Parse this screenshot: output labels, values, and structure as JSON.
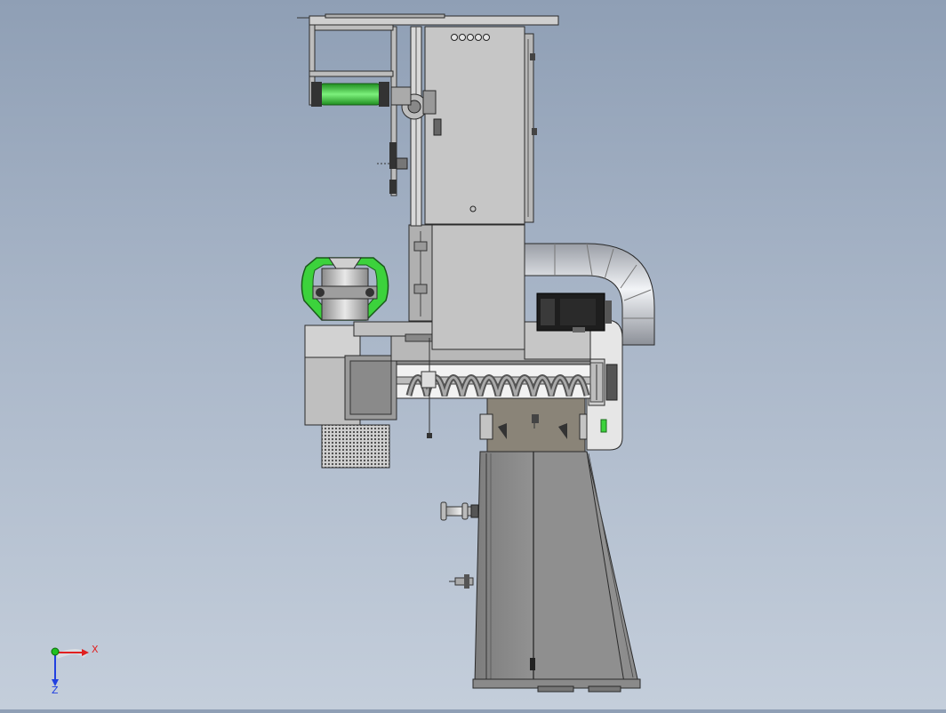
{
  "viewport": {
    "background_top": "#8f9fb5",
    "background_bottom": "#c4cedb"
  },
  "model_colors": {
    "steel": "#c8c8c8",
    "steel_dark": "#8e8e8e",
    "outline": "#2a2a2a",
    "highlight_green": "#3cd23c",
    "motor_black": "#1e1e1e",
    "hopper_brown": "#8a8478"
  },
  "triad": {
    "x_label": "X",
    "z_label": "Z",
    "x_color": "#e02020",
    "y_color": "#20c020",
    "z_color": "#2040e0"
  }
}
